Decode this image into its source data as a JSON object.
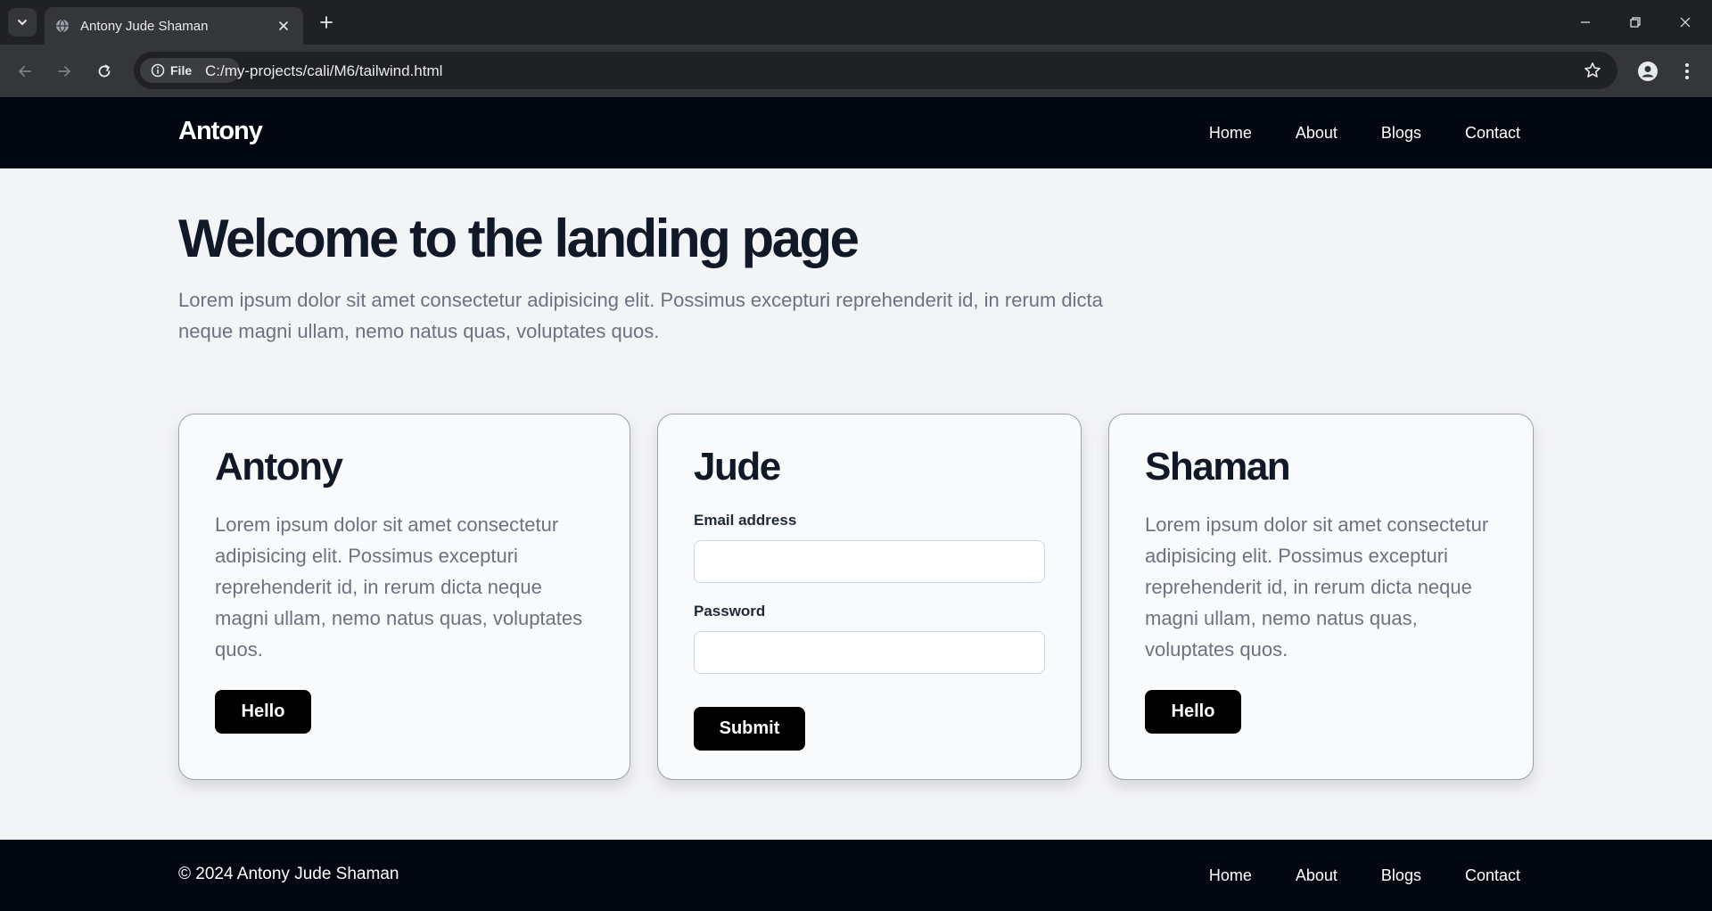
{
  "browser": {
    "tab_title": "Antony Jude Shaman",
    "chip_label": "File",
    "url": "C:/my-projects/cali/M6/tailwind.html"
  },
  "site": {
    "brand": "Antony",
    "nav": [
      "Home",
      "About",
      "Blogs",
      "Contact"
    ]
  },
  "hero": {
    "title": "Welcome to the landing page",
    "text": "Lorem ipsum dolor sit amet consectetur adipisicing elit. Possimus excepturi reprehenderit id, in rerum dicta neque magni ullam, nemo natus quas, voluptates quos."
  },
  "cards": [
    {
      "title": "Antony",
      "text": "Lorem ipsum dolor sit amet consectetur adipisicing elit. Possimus excepturi reprehenderit id, in rerum dicta neque magni ullam, nemo natus quas, voluptates quos.",
      "button": "Hello"
    },
    {
      "title": "Jude",
      "email_label": "Email address",
      "email_value": "",
      "password_label": "Password",
      "password_value": "",
      "button": "Submit"
    },
    {
      "title": "Shaman",
      "text": "Lorem ipsum dolor sit amet consectetur adipisicing elit. Possimus excepturi reprehenderit id, in rerum dicta neque magni ullam, nemo natus quas, voluptates quos.",
      "button": "Hello"
    }
  ],
  "footer": {
    "copyright": "© 2024 Antony Jude Shaman",
    "nav": [
      "Home",
      "About",
      "Blogs",
      "Contact"
    ]
  },
  "colors": {
    "header_bg": "#030712",
    "page_bg": "#f3f4f6",
    "button_bg": "#000000",
    "heading": "#111827",
    "body_text": "#6b7280"
  },
  "icons": [
    "tab-list-icon",
    "globe-icon",
    "close-icon",
    "plus-icon",
    "minimize-icon",
    "restore-icon",
    "back-icon",
    "forward-icon",
    "reload-icon",
    "info-icon",
    "star-icon",
    "profile-icon",
    "more-icon"
  ]
}
